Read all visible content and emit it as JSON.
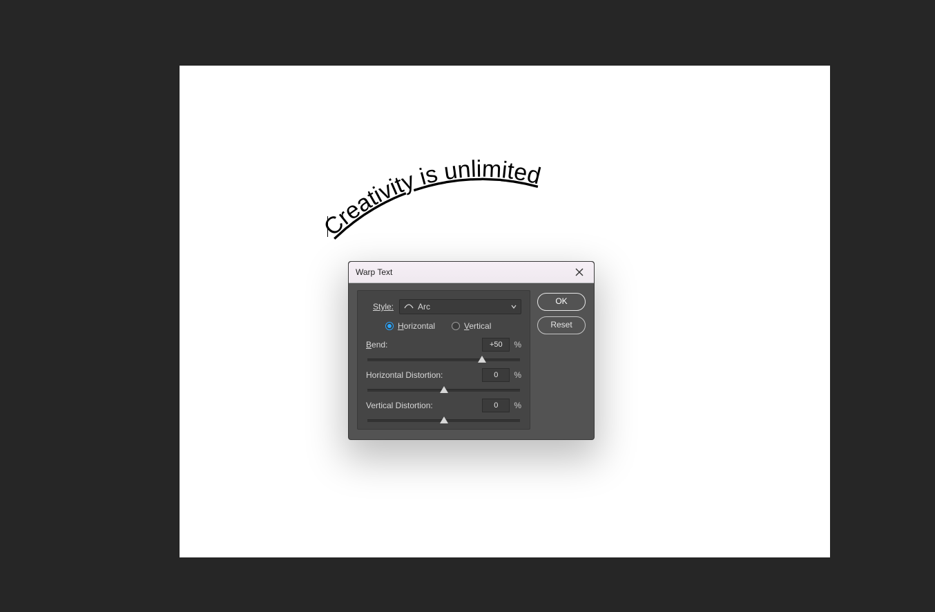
{
  "canvas_text": "Creativity is unlimited",
  "dialog": {
    "title": "Warp Text",
    "style_label": "Style:",
    "style_value": "Arc",
    "horizontal_label": "Horizontal",
    "horizontal_accesskey": "H",
    "vertical_label": "Vertical",
    "vertical_accesskey": "V",
    "orientation_selected": "horizontal",
    "sliders": {
      "bend": {
        "label": "Bend:",
        "accesskey": "B",
        "value": "+50",
        "percent": 75
      },
      "hdist": {
        "label": "Horizontal Distortion:",
        "value": "0",
        "percent": 50
      },
      "vdist": {
        "label": "Vertical Distortion:",
        "value": "0",
        "percent": 50
      }
    },
    "percent_sign": "%",
    "buttons": {
      "ok": "OK",
      "reset": "Reset"
    }
  }
}
